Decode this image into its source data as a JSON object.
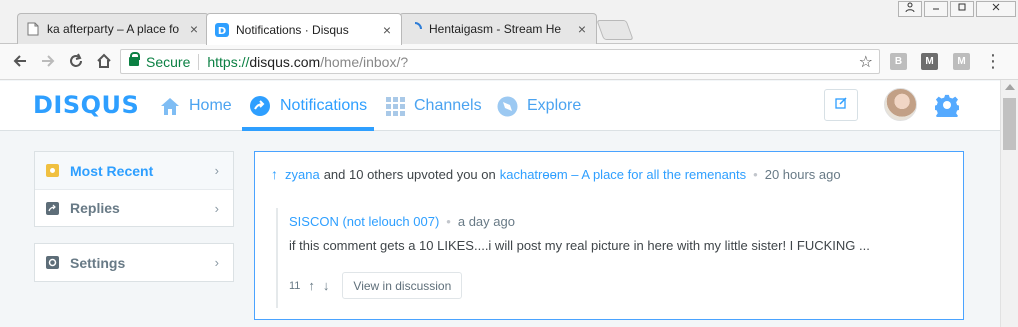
{
  "browser": {
    "tabs": [
      {
        "title": "ka afterparty – A place fo",
        "favicon": "page-icon",
        "active": false
      },
      {
        "title": "Notifications · Disqus",
        "favicon": "disqus-icon",
        "active": true
      },
      {
        "title": "Hentaigasm - Stream He",
        "favicon": "loading-spinner-icon",
        "active": false
      }
    ],
    "close_glyph": "×",
    "window_controls": [
      "person-icon",
      "minimize-icon",
      "maximize-icon",
      "close-icon"
    ],
    "address": {
      "security_label": "Secure",
      "scheme": "https://",
      "host": "disqus.com",
      "path": "/home/inbox/?"
    },
    "extensions": [
      "B",
      "M",
      "M"
    ]
  },
  "disqus": {
    "logo": "DISQUS",
    "nav": [
      {
        "label": "Home",
        "icon": "home-icon"
      },
      {
        "label": "Notifications",
        "icon": "notification-arrow-icon",
        "active": true
      },
      {
        "label": "Channels",
        "icon": "grid-icon"
      },
      {
        "label": "Explore",
        "icon": "compass-icon"
      }
    ],
    "sidebar": {
      "items": [
        {
          "label": "Most Recent",
          "icon": "star-icon",
          "active": true
        },
        {
          "label": "Replies",
          "icon": "reply-icon"
        }
      ],
      "settings": {
        "label": "Settings",
        "icon": "gear-icon"
      },
      "chevron": "›"
    },
    "notification": {
      "user": "zyana",
      "text": "and 10 others upvoted you on",
      "forum": "kachatrɵɵm – A place for all the remenants",
      "time": "20 hours ago",
      "comment": {
        "author": "SISCON (not lelouch 007)",
        "time": "a day ago",
        "body": "if this comment gets a 10 LIKES....i will post my real picture in here with my little sister! I FUCKING ...",
        "votes": "11",
        "view_button": "View in discussion"
      }
    },
    "colors": {
      "brand": "#2e9fff",
      "text": "#3f4549",
      "muted": "#687a86"
    }
  }
}
